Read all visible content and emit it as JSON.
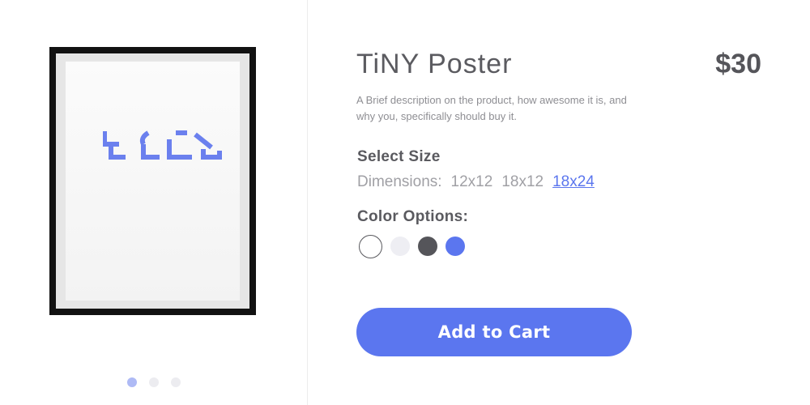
{
  "product": {
    "title": "TiNY Poster",
    "price": "$30",
    "description": "A Brief description on the product, how awesome it is, and why you, specifically should buy it."
  },
  "size": {
    "heading": "Select Size",
    "prefix": "Dimensions:",
    "options": [
      "12x12",
      "18x12",
      "18x24"
    ],
    "selected": "18x24"
  },
  "color": {
    "heading": "Color Options:",
    "swatches": [
      {
        "name": "white",
        "hex": "#ffffff",
        "selected": true
      },
      {
        "name": "light-gray",
        "hex": "#eeeef3",
        "selected": false
      },
      {
        "name": "dark-gray",
        "hex": "#55555a",
        "selected": false
      },
      {
        "name": "blue",
        "hex": "#5b76ef",
        "selected": false
      }
    ]
  },
  "cart": {
    "label": "Add to Cart"
  },
  "gallery": {
    "slide_count": 3,
    "active_slide": 1,
    "art_color": "#6b80ee",
    "frame_color": "#121212"
  },
  "colors": {
    "accent": "#5b76ef",
    "text_dark": "#5a5a5f"
  }
}
